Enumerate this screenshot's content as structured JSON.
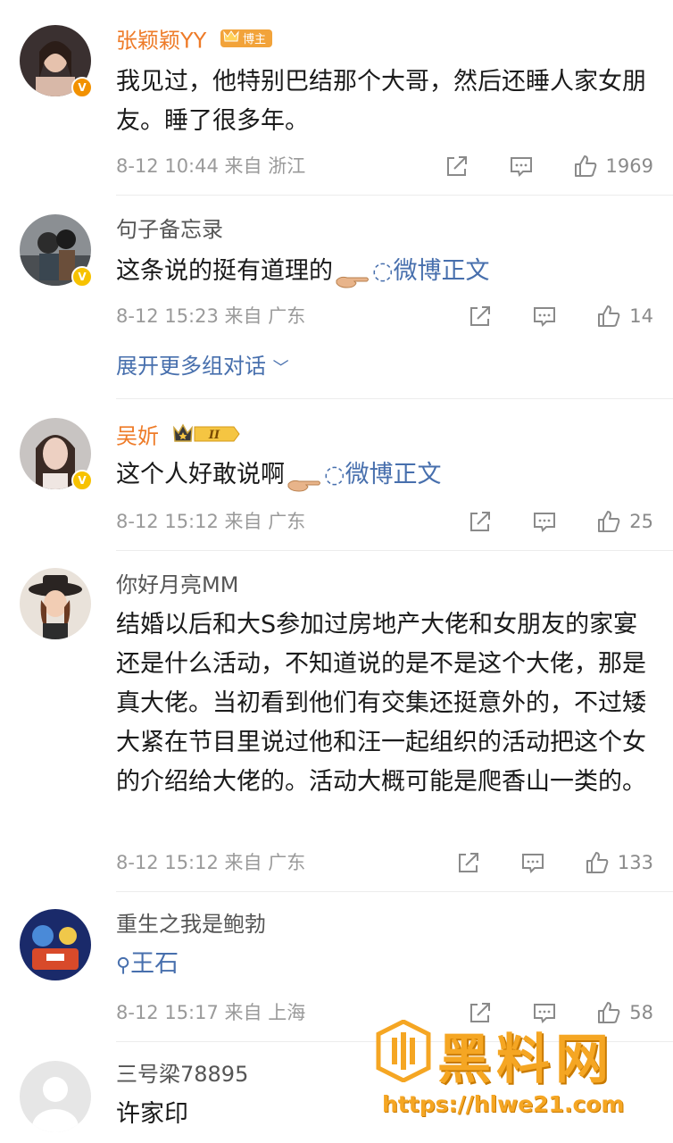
{
  "comments": [
    {
      "name": "张颖颖YY",
      "tag": "博主",
      "text": "我见过，他特别巴结那个大哥，然后还睡人家女朋友。睡了很多年。",
      "meta": "8-12 10:44  来自 浙江",
      "likes": "1969"
    },
    {
      "name": "句子备忘录",
      "text": "这条说的挺有道理的",
      "link": "微博正文",
      "meta": "8-12 15:23  来自 广东",
      "likes": "14",
      "expand": "展开更多组对话"
    },
    {
      "name": "吴妡",
      "tag": "II",
      "text": "这个人好敢说啊",
      "link": "微博正文",
      "meta": "8-12 15:12  来自 广东",
      "likes": "25"
    },
    {
      "name": "你好月亮MM",
      "text": "结婚以后和大S参加过房地产大佬和女朋友的家宴还是什么活动，不知道说的是不是这个大佬，那是真大佬。当初看到他们有交集还挺意外的，不过矮大紧在节目里说过他和汪一起组织的活动把这个女的介绍给大佬的。活动大概可能是爬香山一类的。",
      "meta": "8-12 15:12  来自 广东",
      "likes": "133"
    },
    {
      "name": "重生之我是鲍勃",
      "link": "王石",
      "meta": "8-12 15:17  来自 上海",
      "likes": "58"
    },
    {
      "name": "三号梁78895",
      "text": "许家印"
    }
  ],
  "watermark": {
    "title": "黑料网",
    "url": "https://hlwe21.com"
  },
  "colors": {
    "vip_name": "#ee7b28",
    "link": "#476fad",
    "meta": "#9a9a9a",
    "watermark": "#f5a623"
  }
}
